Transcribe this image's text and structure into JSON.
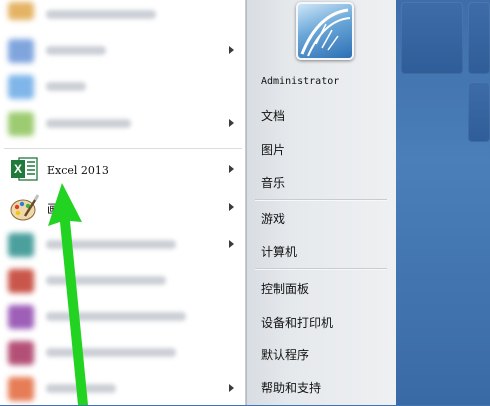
{
  "left_menu": {
    "excel_label": "Excel 2013",
    "paint_label": "画"
  },
  "right_menu": {
    "user_name": "Administrator",
    "items": [
      "文档",
      "图片",
      "音乐",
      "游戏",
      "计算机",
      "控制面板",
      "设备和打印机",
      "默认程序",
      "帮助和支持"
    ]
  },
  "colors": {
    "excel_green": "#1f7a3c",
    "annotation_arrow": "#22d322",
    "desktop_blue": "#3f74b0"
  }
}
